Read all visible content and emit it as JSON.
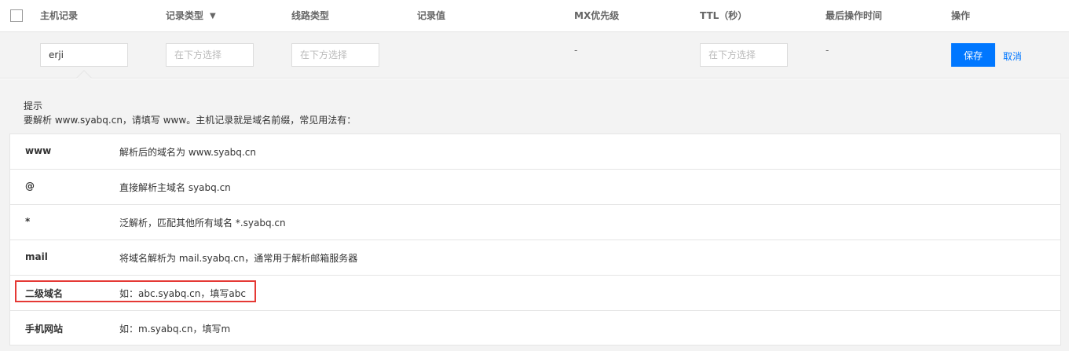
{
  "header": {
    "host_record": "主机记录",
    "record_type": "记录类型",
    "line_type": "线路类型",
    "record_value": "记录值",
    "mx_priority": "MX优先级",
    "ttl": "TTL（秒）",
    "last_op_time": "最后操作时间",
    "actions": "操作"
  },
  "edit_row": {
    "host_value": "erji",
    "type_placeholder": "在下方选择",
    "line_placeholder": "在下方选择",
    "mx_value": "-",
    "ttl_placeholder": "在下方选择",
    "last_time_value": "-",
    "save_label": "保存",
    "cancel_label": "取消"
  },
  "tip": {
    "title": "提示",
    "description": "要解析 www.syabq.cn，请填写 www。主机记录就是域名前缀，常见用法有：",
    "rows": [
      {
        "key": "www",
        "value": "解析后的域名为 www.syabq.cn"
      },
      {
        "key": "@",
        "value": "直接解析主域名 syabq.cn"
      },
      {
        "key": "*",
        "value": "泛解析，匹配其他所有域名 *.syabq.cn"
      },
      {
        "key": "mail",
        "value": "将域名解析为 mail.syabq.cn，通常用于解析邮箱服务器"
      },
      {
        "key": "二级域名",
        "value": "如：abc.syabq.cn，填写abc"
      },
      {
        "key": "手机网站",
        "value": "如：m.syabq.cn，填写m"
      }
    ]
  },
  "colors": {
    "primary": "#0077ff",
    "highlight": "#e53935"
  },
  "icons": {
    "filter": "filter-icon"
  }
}
